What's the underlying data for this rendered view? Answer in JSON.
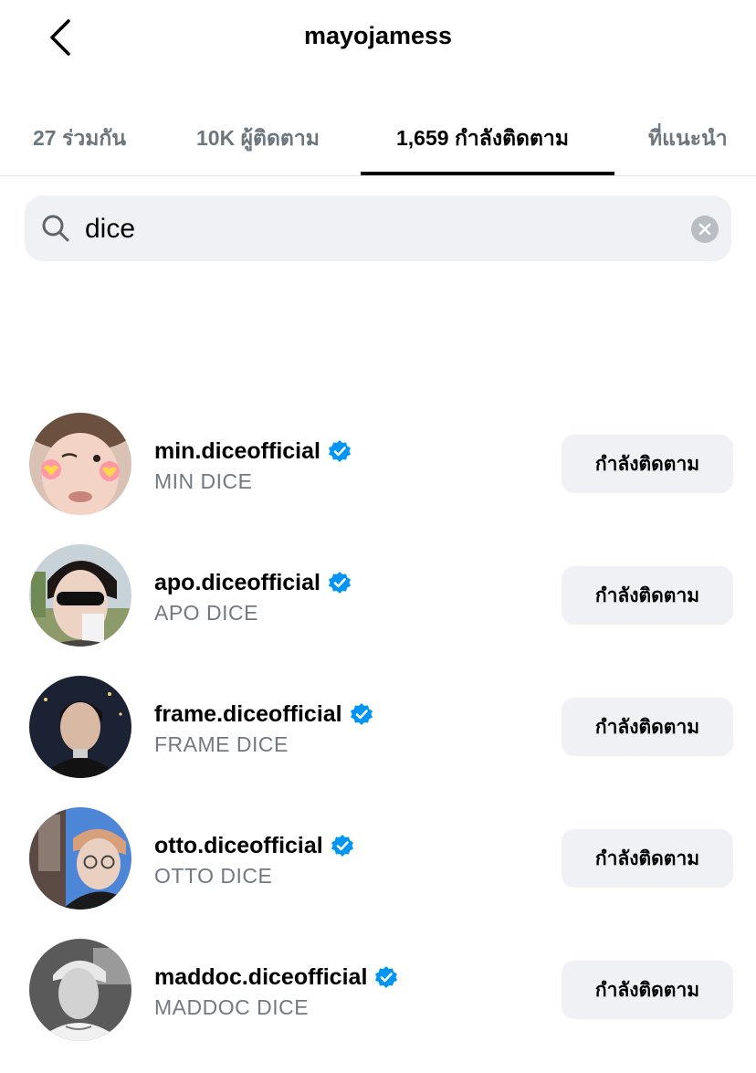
{
  "header": {
    "title": "mayojamess"
  },
  "tabs": [
    {
      "label": "27 ร่วมกัน"
    },
    {
      "label": "10K ผู้ติดตาม"
    },
    {
      "label": "1,659 กำลังติดตาม"
    },
    {
      "label": "ที่แนะนำ"
    }
  ],
  "search": {
    "value": "dice"
  },
  "accent_color": "#0095f6",
  "results": [
    {
      "username": "min.diceofficial",
      "name": "MIN DICE",
      "button": "กำลังติดตาม",
      "verified": true
    },
    {
      "username": "apo.diceofficial",
      "name": "APO DICE",
      "button": "กำลังติดตาม",
      "verified": true
    },
    {
      "username": "frame.diceofficial",
      "name": "FRAME DICE",
      "button": "กำลังติดตาม",
      "verified": true
    },
    {
      "username": "otto.diceofficial",
      "name": "OTTO DICE",
      "button": "กำลังติดตาม",
      "verified": true
    },
    {
      "username": "maddoc.diceofficial",
      "name": "MADDOC DICE",
      "button": "กำลังติดตาม",
      "verified": true
    }
  ]
}
